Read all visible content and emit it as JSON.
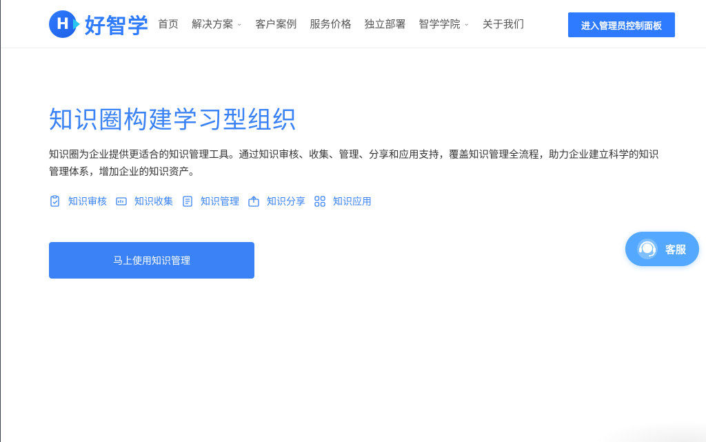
{
  "header": {
    "logo_letter": "H",
    "logo_text": "好智学",
    "nav": [
      {
        "label": "首页",
        "dropdown": false
      },
      {
        "label": "解决方案",
        "dropdown": true
      },
      {
        "label": "客户案例",
        "dropdown": false
      },
      {
        "label": "服务价格",
        "dropdown": false
      },
      {
        "label": "独立部署",
        "dropdown": false
      },
      {
        "label": "智学学院",
        "dropdown": true
      },
      {
        "label": "关于我们",
        "dropdown": false
      }
    ],
    "admin_button": "进入管理员控制面板"
  },
  "hero": {
    "title": "知识圈构建学习型组织",
    "description": "知识圈为企业提供更适合的知识管理工具。通过知识审核、收集、管理、分享和应用支持，覆盖知识管理全流程，助力企业建立科学的知识管理体系，增加企业的知识资产。",
    "features": [
      {
        "icon": "review-icon",
        "label": "知识审核"
      },
      {
        "icon": "collect-icon",
        "label": "知识收集"
      },
      {
        "icon": "manage-icon",
        "label": "知识管理"
      },
      {
        "icon": "share-icon",
        "label": "知识分享"
      },
      {
        "icon": "apps-icon",
        "label": "知识应用"
      }
    ],
    "cta": "马上使用知识管理"
  },
  "service": {
    "icon": "headset-icon",
    "label": "客服"
  },
  "colors": {
    "brand": "#2f7bff",
    "accent": "#3a82f6",
    "service": "#54a8ff"
  }
}
